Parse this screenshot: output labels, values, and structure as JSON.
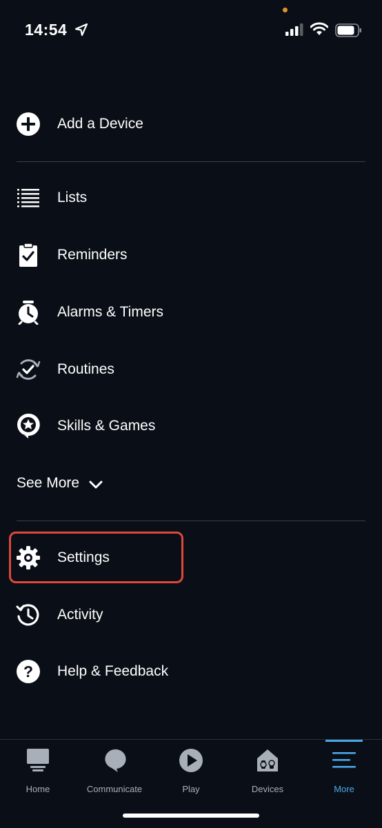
{
  "status_bar": {
    "time": "14:54",
    "icons": [
      "location-arrow-icon",
      "signal-icon",
      "wifi-icon",
      "battery-icon"
    ]
  },
  "menu": {
    "add_device": {
      "label": "Add a Device",
      "icon": "plus-circle-icon"
    },
    "items": [
      {
        "label": "Lists",
        "icon": "list-icon"
      },
      {
        "label": "Reminders",
        "icon": "clipboard-check-icon"
      },
      {
        "label": "Alarms & Timers",
        "icon": "alarm-clock-icon"
      },
      {
        "label": "Routines",
        "icon": "routine-check-icon"
      },
      {
        "label": "Skills & Games",
        "icon": "star-bubble-icon"
      }
    ],
    "see_more": {
      "label": "See More",
      "icon": "chevron-down-icon"
    },
    "lower_items": [
      {
        "label": "Settings",
        "icon": "gear-icon",
        "highlighted": true
      },
      {
        "label": "Activity",
        "icon": "history-icon"
      },
      {
        "label": "Help & Feedback",
        "icon": "question-circle-icon"
      }
    ],
    "highlight_color": "#e0483c"
  },
  "tab_bar": {
    "tabs": [
      {
        "label": "Home",
        "icon": "home-icon"
      },
      {
        "label": "Communicate",
        "icon": "chat-bubble-icon"
      },
      {
        "label": "Play",
        "icon": "play-icon"
      },
      {
        "label": "Devices",
        "icon": "devices-icon"
      },
      {
        "label": "More",
        "icon": "menu-lines-icon",
        "active": true
      }
    ],
    "active_color": "#4aa8e8"
  }
}
